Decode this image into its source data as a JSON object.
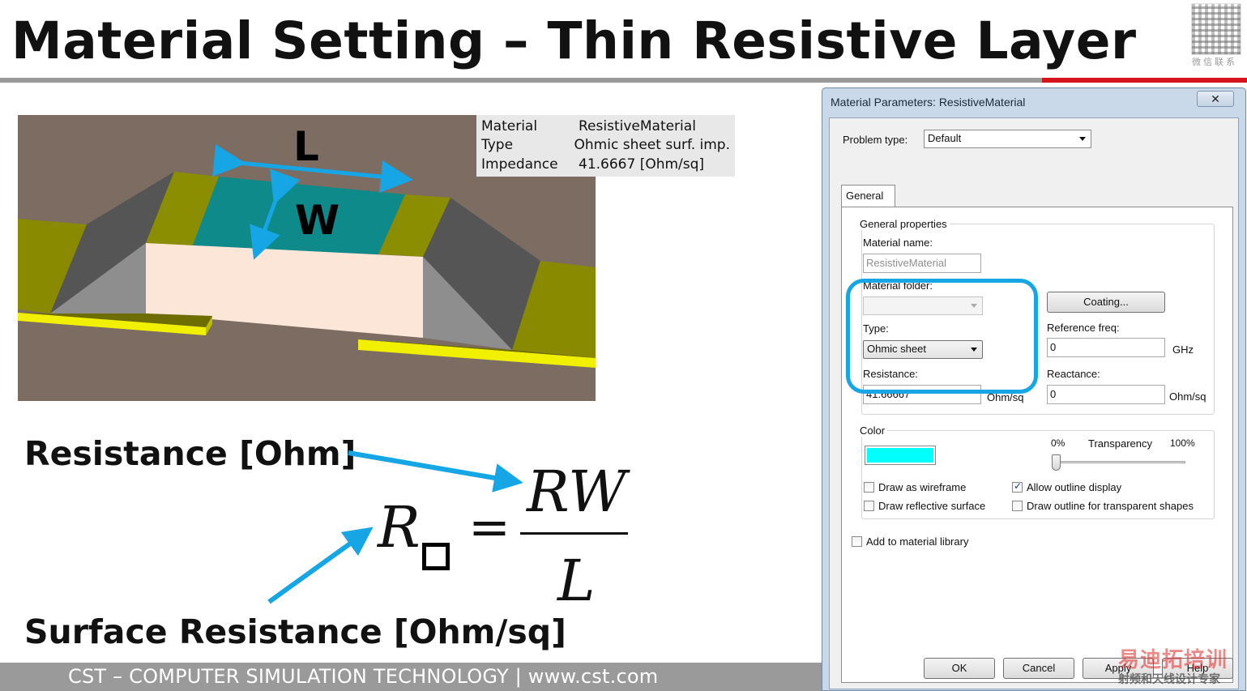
{
  "slide": {
    "title": "Material Setting – Thin Resistive Layer",
    "footer": "CST – COMPUTER SIMULATION TECHNOLOGY | www.cst.com",
    "qr_caption": "微信联系",
    "watermark_top": "易迪拓培训",
    "watermark_bottom": "射频和天线设计专家"
  },
  "view3d": {
    "label_length": "L",
    "label_width": "W",
    "info": [
      {
        "key": "Material",
        "value": "ResistiveMaterial"
      },
      {
        "key": "Type",
        "value": "Ohmic sheet surf. imp."
      },
      {
        "key": "Impedance",
        "value": "41.6667 [Ohm/sq]"
      }
    ]
  },
  "formula": {
    "resistance_label": "Resistance [Ohm]",
    "surface_label": "Surface Resistance [Ohm/sq]",
    "lhs": "R",
    "numerator": "RW",
    "equals": "=",
    "denominator": "L"
  },
  "dialog": {
    "title": "Material Parameters: ResistiveMaterial",
    "close": "✕",
    "problem_type_label": "Problem type:",
    "problem_type_value": "Default",
    "tab_general": "General",
    "group_general": "General properties",
    "material_name_label": "Material name:",
    "material_name_value": "ResistiveMaterial",
    "material_folder_label": "Material folder:",
    "material_folder_value": "",
    "coating_button": "Coating...",
    "type_label": "Type:",
    "type_value": "Ohmic sheet",
    "ref_freq_label": "Reference freq:",
    "ref_freq_value": "0",
    "ref_freq_unit": "GHz",
    "resistance_label": "Resistance:",
    "resistance_value": "41.66667",
    "resistance_unit": "Ohm/sq",
    "reactance_label": "Reactance:",
    "reactance_value": "0",
    "reactance_unit": "Ohm/sq",
    "group_color": "Color",
    "color_value": "#00ffff",
    "transparency_label": "Transparency",
    "transparency_min": "0%",
    "transparency_max": "100%",
    "transparency_level": 0,
    "cb_wireframe": "Draw as wireframe",
    "cb_reflective": "Draw reflective surface",
    "cb_outline": "Allow outline display",
    "cb_outline_transparent": "Draw outline for transparent shapes",
    "cb_library": "Add to material library",
    "btn_ok": "OK",
    "btn_cancel": "Cancel",
    "btn_apply": "Apply",
    "btn_help": "Help"
  },
  "colors": {
    "highlight": "#16a6e6",
    "arrow": "#16a6e6",
    "footer_bar": "#9a9a9a",
    "title_rule_red": "#d6141c"
  }
}
